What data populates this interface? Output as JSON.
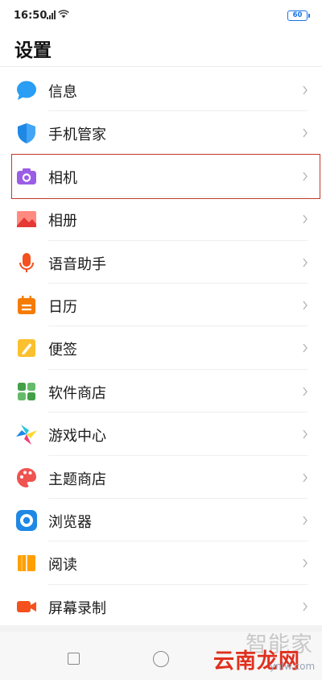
{
  "status_bar": {
    "time": "16:50",
    "battery": "60"
  },
  "page_title": "设置",
  "items": [
    {
      "label": "信息",
      "icon": "message-icon"
    },
    {
      "label": "手机管家",
      "icon": "shield-icon"
    },
    {
      "label": "相机",
      "icon": "camera-icon"
    },
    {
      "label": "相册",
      "icon": "gallery-icon"
    },
    {
      "label": "语音助手",
      "icon": "microphone-icon"
    },
    {
      "label": "日历",
      "icon": "calendar-icon"
    },
    {
      "label": "便签",
      "icon": "note-icon"
    },
    {
      "label": "软件商店",
      "icon": "app-store-icon"
    },
    {
      "label": "游戏中心",
      "icon": "game-center-icon"
    },
    {
      "label": "主题商店",
      "icon": "palette-icon"
    },
    {
      "label": "浏览器",
      "icon": "browser-icon"
    },
    {
      "label": "阅读",
      "icon": "book-icon"
    },
    {
      "label": "屏幕录制",
      "icon": "screen-record-icon"
    }
  ],
  "highlighted_item": "相机",
  "watermark": {
    "line1": "智能家",
    "line2": "云南龙网",
    "url": "ynlw.com"
  },
  "colors": {
    "highlight_border": "#c0392b",
    "accent_blue": "#1a73e8"
  }
}
